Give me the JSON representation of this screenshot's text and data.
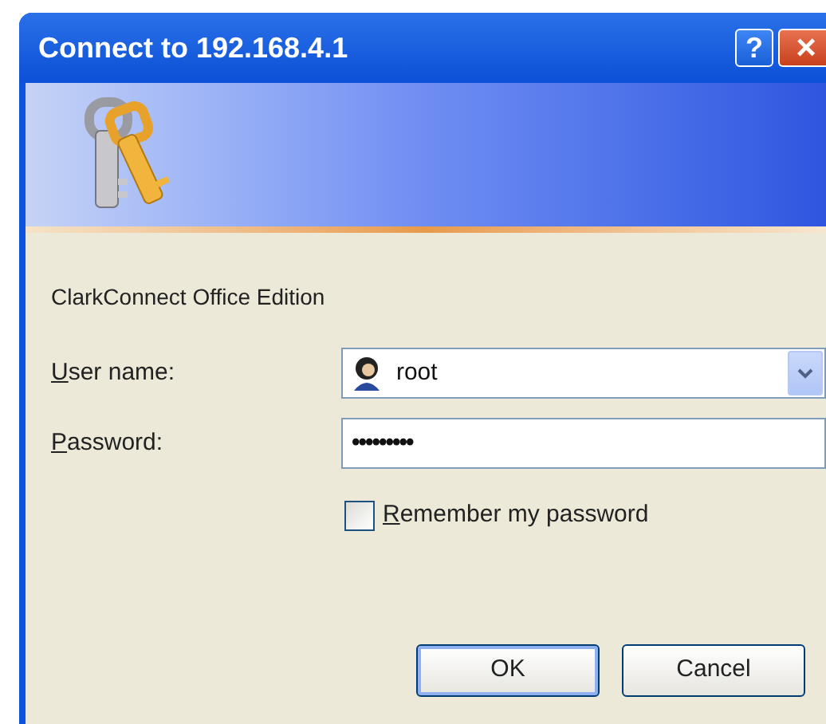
{
  "window": {
    "title": "Connect to 192.168.4.1",
    "title_buttons": [
      {
        "kind": "help",
        "label": "?"
      },
      {
        "kind": "close",
        "label": "×"
      }
    ]
  },
  "banner": {
    "kind": "keys"
  },
  "realm": "ClarkConnect Office Edition",
  "fields": [
    {
      "kind": "combo",
      "label": "User name:",
      "value": "root"
    },
    {
      "kind": "password",
      "label": "Password:",
      "value": "•••••••••"
    }
  ],
  "remember": {
    "label": "Remember my password",
    "checked": false
  },
  "buttons": [
    {
      "label": "OK",
      "default": true
    },
    {
      "label": "Cancel",
      "default": false
    }
  ]
}
